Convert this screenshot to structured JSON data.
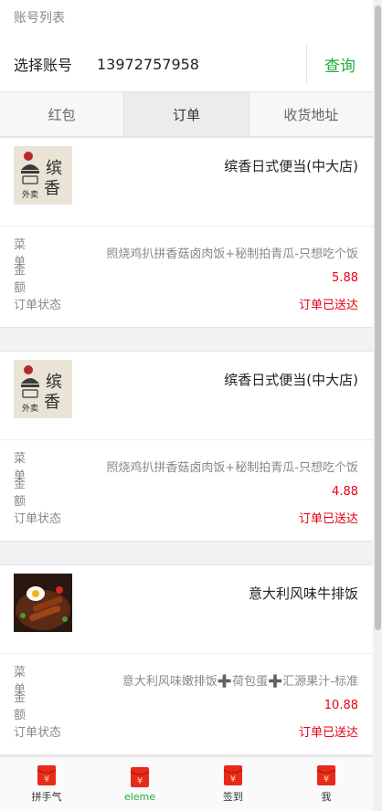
{
  "header": {
    "section_title": "账号列表"
  },
  "account": {
    "label": "选择账号",
    "value": "13972757958",
    "query_label": "查询"
  },
  "tabs": [
    {
      "label": "红包"
    },
    {
      "label": "订单"
    },
    {
      "label": "收货地址"
    }
  ],
  "labels": {
    "dish": "菜单",
    "amount": "金额",
    "status": "订单状态"
  },
  "orders": [
    {
      "shop": "缤香日式便当(中大店)",
      "dish": "照烧鸡扒拼香菇卤肉饭+秘制拍青瓜-只想吃个饭",
      "amount": "5.88",
      "status": "订单已送达",
      "logo": "binxiang-logo"
    },
    {
      "shop": "缤香日式便当(中大店)",
      "dish": "照烧鸡扒拼香菇卤肉饭+秘制拍青瓜-只想吃个饭",
      "amount": "4.88",
      "status": "订单已送达",
      "logo": "binxiang-logo"
    },
    {
      "shop": "意大利风味牛排饭",
      "dish": "意大利风味嫩排饭➕荷包蛋➕汇源果汁-标准",
      "amount": "10.88",
      "status": "订单已送达",
      "logo": "steak-rice-photo"
    }
  ],
  "bottom_nav": [
    {
      "label": "拼手气",
      "icon": "red-envelope-icon"
    },
    {
      "label": "eleme",
      "icon": "red-envelope-icon"
    },
    {
      "label": "签到",
      "icon": "red-envelope-icon"
    },
    {
      "label": "我",
      "icon": "red-envelope-icon"
    }
  ],
  "colors": {
    "accent_green": "#22ac38",
    "status_red": "#e60012",
    "envelope_red": "#e8291c"
  }
}
